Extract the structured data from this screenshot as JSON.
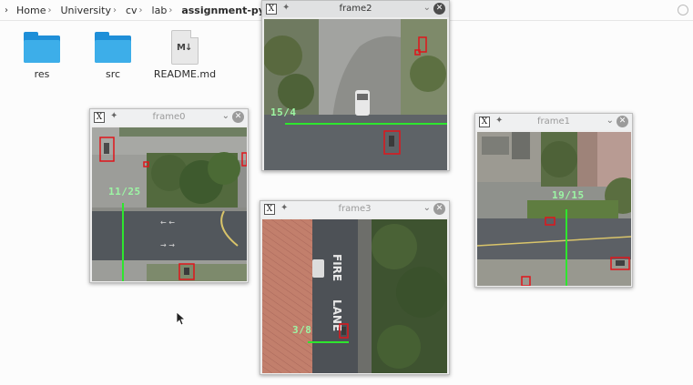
{
  "breadcrumb": {
    "items": [
      "Home",
      "University",
      "cv",
      "lab"
    ],
    "current": "assignment-python-final"
  },
  "files": [
    {
      "name": "res",
      "icon": "folder-icon"
    },
    {
      "name": "src",
      "icon": "folder-icon"
    },
    {
      "name": "README.md",
      "icon": "markdown-file-icon"
    }
  ],
  "windows": {
    "frame0": {
      "title": "frame0",
      "counter": "11/25"
    },
    "frame1": {
      "title": "frame1",
      "counter": "19/15"
    },
    "frame2": {
      "title": "frame2",
      "counter": "15/4"
    },
    "frame3": {
      "title": "frame3",
      "counter": "3/8"
    }
  },
  "road_markings": {
    "word1": "FIRE",
    "word2": "LANE"
  },
  "colors": {
    "detection_box": "#e0151b",
    "counting_line": "#2ee62e",
    "counter_text": "#9cf5a4",
    "folder": "#3daee9"
  }
}
